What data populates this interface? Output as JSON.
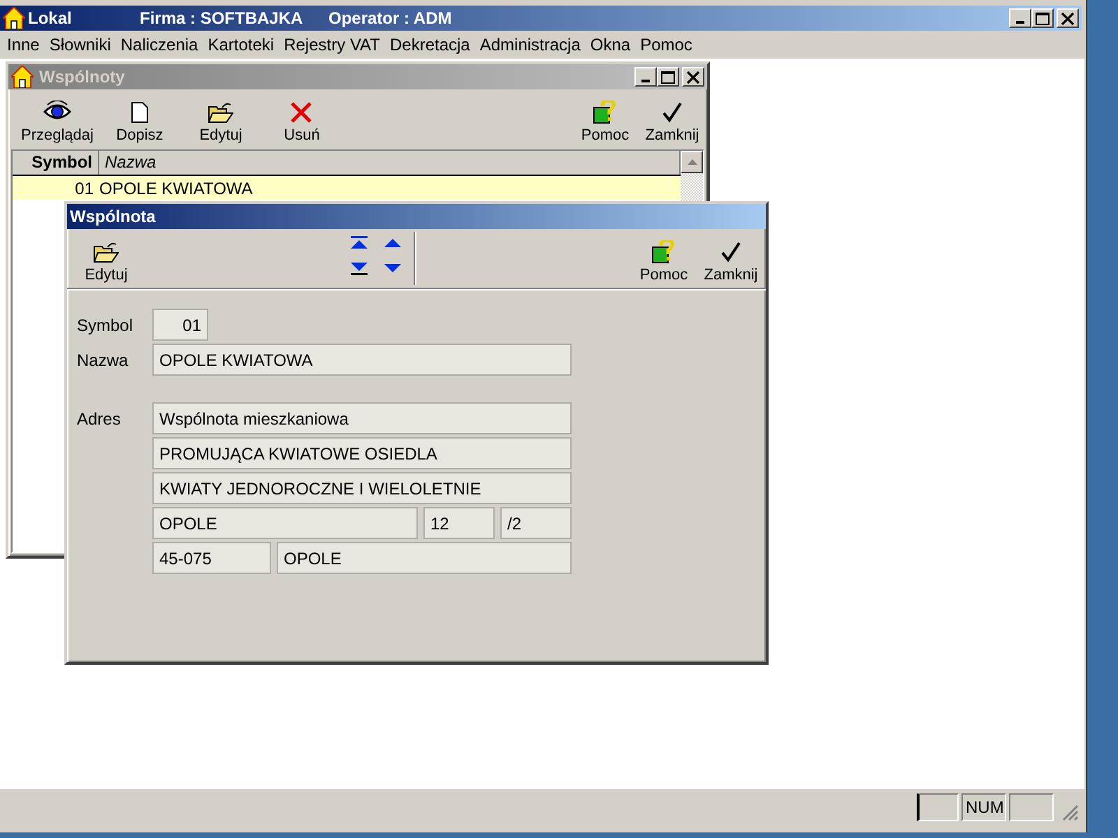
{
  "window": {
    "title": "Lokal",
    "company": "Firma : SOFTBAJKA",
    "operator": "Operator : ADM"
  },
  "menu": [
    "Inne",
    "Słowniki",
    "Naliczenia",
    "Kartoteki",
    "Rejestry VAT",
    "Dekretacja",
    "Administracja",
    "Okna",
    "Pomoc"
  ],
  "list_window": {
    "title": "Wspólnoty",
    "active": false,
    "toolbar_left": [
      {
        "label": "Przeglądaj",
        "kind": "view"
      },
      {
        "label": "Dopisz",
        "kind": "add"
      },
      {
        "label": "Edytuj",
        "kind": "edit"
      },
      {
        "label": "Usuń",
        "kind": "delete"
      }
    ],
    "toolbar_right": [
      {
        "label": "Pomoc",
        "kind": "help"
      },
      {
        "label": "Zamknij",
        "kind": "close"
      }
    ],
    "columns": [
      "Symbol",
      "Nazwa"
    ],
    "rows": [
      {
        "symbol": "01",
        "name": "OPOLE KWIATOWA",
        "selected": true
      }
    ]
  },
  "detail_window": {
    "title": "Wspólnota",
    "active": true,
    "toolbar_left": [
      {
        "label": "Edytuj",
        "kind": "edit"
      }
    ],
    "toolbar_right": [
      {
        "label": "Pomoc",
        "kind": "help"
      },
      {
        "label": "Zamknij",
        "kind": "close"
      }
    ],
    "symbol": {
      "label": "Symbol",
      "value": "01"
    },
    "name": {
      "label": "Nazwa",
      "value": "OPOLE KWIATOWA"
    },
    "address": {
      "label": "Adres",
      "lines": [
        "Wspólnota mieszkaniowa",
        "PROMUJĄCA KWIATOWE OSIEDLA",
        "KWIATY JEDNOROCZNE I WIELOLETNIE"
      ],
      "city": "OPOLE",
      "house_number": "12",
      "flat_number": "/2",
      "postal_code": "45-075",
      "post_office": "OPOLE"
    }
  },
  "status_bar": {
    "num_indicator": "NUM"
  }
}
